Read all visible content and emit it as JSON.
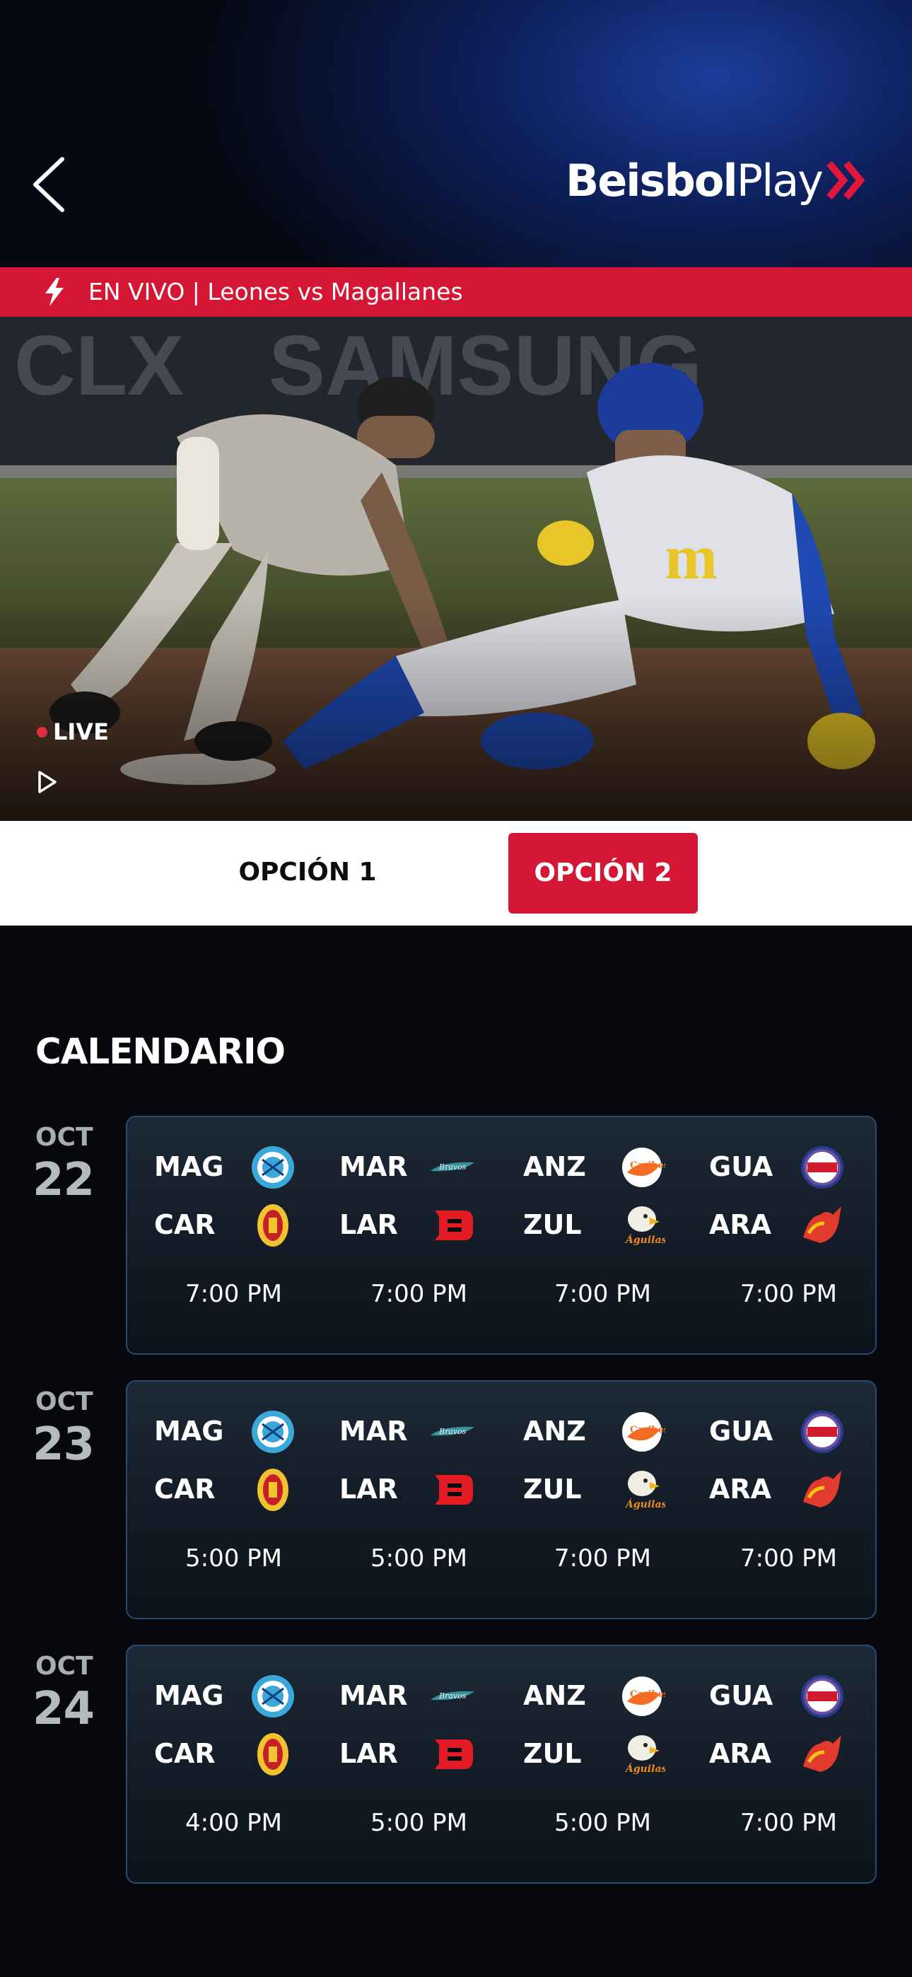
{
  "header": {
    "brand_bold": "Beisbol",
    "brand_light": "Play"
  },
  "live_banner": {
    "text": "EN VIVO | Leones vs Magallanes"
  },
  "video": {
    "live_label": "LIVE"
  },
  "options": {
    "option1": "OPCIÓN 1",
    "option2": "OPCIÓN 2"
  },
  "calendar": {
    "title": "CALENDARIO",
    "days": [
      {
        "month": "OCT",
        "day": "22",
        "games": [
          {
            "home": "MAG",
            "away": "CAR",
            "time": "7:00 PM"
          },
          {
            "home": "MAR",
            "away": "LAR",
            "time": "7:00 PM"
          },
          {
            "home": "ANZ",
            "away": "ZUL",
            "time": "7:00 PM"
          },
          {
            "home": "GUA",
            "away": "ARA",
            "time": "7:00 PM"
          }
        ]
      },
      {
        "month": "OCT",
        "day": "23",
        "games": [
          {
            "home": "MAG",
            "away": "CAR",
            "time": "5:00 PM"
          },
          {
            "home": "MAR",
            "away": "LAR",
            "time": "5:00 PM"
          },
          {
            "home": "ANZ",
            "away": "ZUL",
            "time": "7:00 PM"
          },
          {
            "home": "GUA",
            "away": "ARA",
            "time": "7:00 PM"
          }
        ]
      },
      {
        "month": "OCT",
        "day": "24",
        "games": [
          {
            "home": "MAG",
            "away": "CAR",
            "time": "4:00 PM"
          },
          {
            "home": "MAR",
            "away": "LAR",
            "time": "5:00 PM"
          },
          {
            "home": "ANZ",
            "away": "ZUL",
            "time": "5:00 PM"
          },
          {
            "home": "GUA",
            "away": "ARA",
            "time": "7:00 PM"
          }
        ]
      }
    ]
  },
  "colors": {
    "accent": "#d51635",
    "header_blue": "#1b3d9a",
    "background": "#06080d",
    "card_border": "#2b4a6e"
  }
}
